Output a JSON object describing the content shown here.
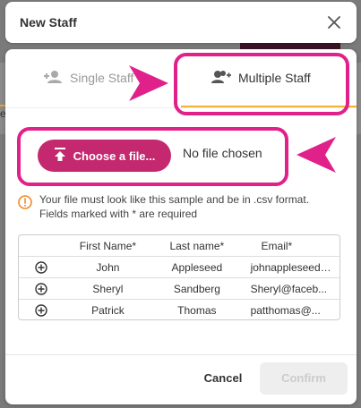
{
  "header": {
    "title": "New Staff"
  },
  "tabs": [
    {
      "label": "Single Staff"
    },
    {
      "label": "Multiple Staff"
    }
  ],
  "upload": {
    "button_label": "Choose a file...",
    "status": "No file chosen"
  },
  "info": {
    "line1": "Your file must look like this sample and be in .csv format.",
    "line2": "Fields marked with * are required"
  },
  "table": {
    "headers": [
      "First Name*",
      "Last name*",
      "Email*"
    ],
    "rows": [
      {
        "first": "John",
        "last": "Appleseed",
        "email": "johnappleseed@..."
      },
      {
        "first": "Sheryl",
        "last": "Sandberg",
        "email": "Sheryl@faceb..."
      },
      {
        "first": "Patrick",
        "last": "Thomas",
        "email": "patthomas@..."
      }
    ]
  },
  "footer": {
    "cancel_label": "Cancel",
    "confirm_label": "Confirm"
  },
  "colors": {
    "accent": "#c4286f",
    "highlight": "#e0218a",
    "tab_indicator": "#f2b233",
    "info_icon": "#f08a24"
  },
  "background": {
    "text_fragment": "es"
  }
}
